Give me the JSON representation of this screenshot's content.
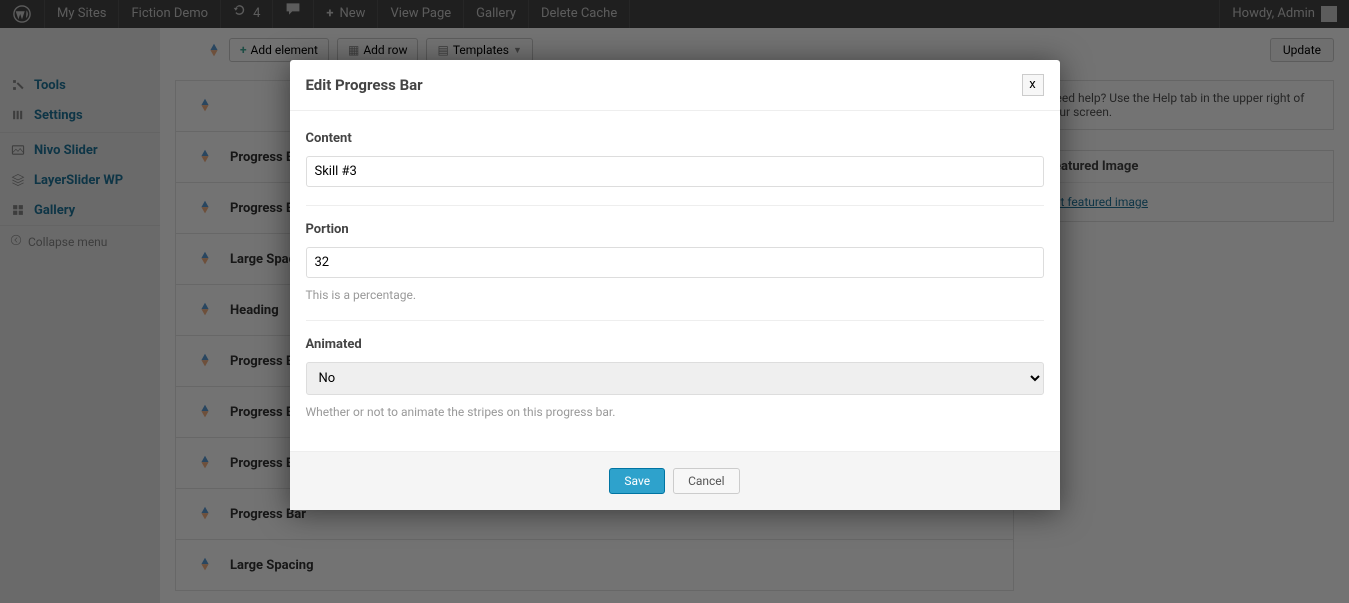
{
  "adminbar": {
    "my_sites": "My Sites",
    "site_name": "Fiction Demo",
    "updates_count": "4",
    "new_label": "New",
    "view_page": "View Page",
    "gallery": "Gallery",
    "delete_cache": "Delete Cache",
    "howdy": "Howdy, Admin"
  },
  "sidebar": {
    "items": [
      {
        "label": "Tools",
        "bold": true
      },
      {
        "label": "Settings",
        "bold": true
      },
      {
        "label": "Nivo Slider",
        "bold": true
      },
      {
        "label": "LayerSlider WP",
        "bold": true
      },
      {
        "label": "Gallery",
        "bold": true
      }
    ],
    "collapse": "Collapse menu"
  },
  "toolbar": {
    "add_element": "Add element",
    "add_row": "Add row",
    "templates": "Templates",
    "update": "Update"
  },
  "elements": [
    {
      "label": ""
    },
    {
      "label": "Progress Bar"
    },
    {
      "label": "Progress Bar"
    },
    {
      "label": "Large Spacing"
    },
    {
      "label": "Heading"
    },
    {
      "label": "Progress Bar"
    },
    {
      "label": "Progress Bar"
    },
    {
      "label": "Progress Bar"
    },
    {
      "label": "Progress Bar"
    },
    {
      "label": "Large Spacing"
    }
  ],
  "help_text": "Need help? Use the Help tab in the upper right of your screen.",
  "featured_image": {
    "title": "Featured Image",
    "link": "Set featured image"
  },
  "modal": {
    "title": "Edit Progress Bar",
    "close": "x",
    "fields": {
      "content": {
        "label": "Content",
        "value": "Skill #3"
      },
      "portion": {
        "label": "Portion",
        "value": "32",
        "desc": "This is a percentage."
      },
      "animated": {
        "label": "Animated",
        "selected": "No",
        "desc": "Whether or not to animate the stripes on this progress bar."
      }
    },
    "save": "Save",
    "cancel": "Cancel"
  }
}
